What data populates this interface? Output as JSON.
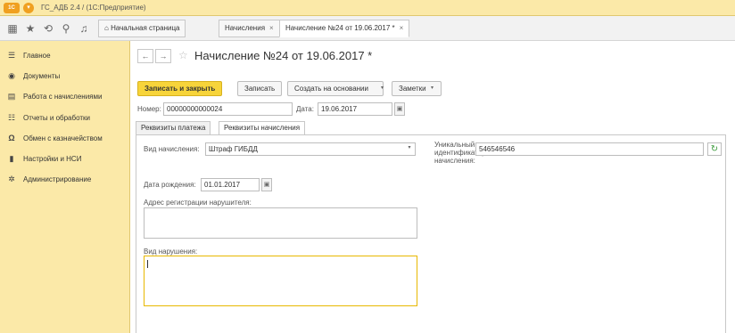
{
  "titlebar": {
    "logo_text": "1С",
    "app_title": "ГС_АДБ 2.4 /  (1С:Предприятие)"
  },
  "tabs": [
    {
      "label": "Начальная страница"
    },
    {
      "label": "Начисления",
      "close": "×"
    },
    {
      "label": "Начисление №24 от 19.06.2017 *",
      "close": "×"
    }
  ],
  "sidebar": {
    "items": [
      {
        "label": "Главное",
        "icon": "menu-icon"
      },
      {
        "label": "Документы",
        "icon": "documents-icon"
      },
      {
        "label": "Работа с начислениями",
        "icon": "accruals-icon"
      },
      {
        "label": "Отчеты и обработки",
        "icon": "reports-icon"
      },
      {
        "label": "Обмен с казначейством",
        "icon": "treasury-icon"
      },
      {
        "label": "Настройки и НСИ",
        "icon": "settings-icon"
      },
      {
        "label": "Администрирование",
        "icon": "admin-icon"
      }
    ]
  },
  "document": {
    "title": "Начисление №24 от 19.06.2017 *"
  },
  "toolbar": {
    "save_close": "Записать и закрыть",
    "save": "Записать",
    "create_based": "Создать на основании",
    "notes": "Заметки"
  },
  "header_fields": {
    "number_label": "Номер:",
    "number_value": "00000000000024",
    "date_label": "Дата:",
    "date_value": "19.06.2017"
  },
  "form_tabs": [
    {
      "label": "Реквизиты платежа"
    },
    {
      "label": "Реквизиты начисления"
    }
  ],
  "accrual": {
    "type_label": "Вид начисления:",
    "type_value": "Штраф ГИБДД",
    "uid_label_1": "Уникальный",
    "uid_label_2": "идентификатор",
    "uid_label_3": "начисления:",
    "uid_value": "546546546",
    "birth_label": "Дата рождения:",
    "birth_value": "01.01.2017",
    "address_label": "Адрес регистрации нарушителя:",
    "address_value": "",
    "violation_label": "Вид нарушения:",
    "violation_value": ""
  },
  "colors": {
    "sidebar_bg": "#fbe9a8",
    "primary_button": "#f7d43a",
    "focus_border": "#e8b800"
  }
}
